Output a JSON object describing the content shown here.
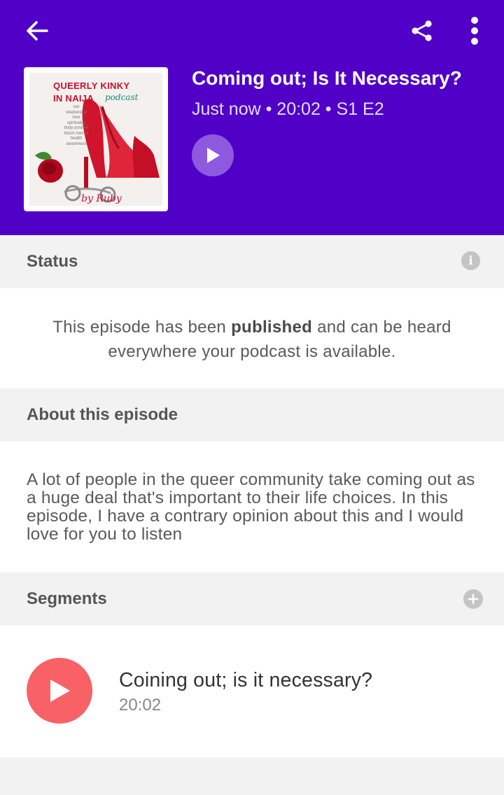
{
  "header": {
    "back_icon": "arrow-left-icon",
    "share_icon": "share-icon",
    "more_icon": "more-vertical-icon",
    "background": "#5000c7"
  },
  "artwork": {
    "line1": "QUEERLY KINKY",
    "line2": "IN NAIJA",
    "podcast": "podcast",
    "tags": [
      "sex",
      "relationship",
      "love",
      "spirituality",
      "body positive",
      "bdsm mental",
      "health",
      "awareness"
    ],
    "byline": "by Ruby"
  },
  "episode": {
    "title": "Coming out; Is It Necessary?",
    "meta": "Just now • 20:02 • S1 E2"
  },
  "status": {
    "heading": "Status",
    "text_before": "This episode has been ",
    "text_bold": "published",
    "text_after": " and can be heard everywhere your podcast is available."
  },
  "about": {
    "heading": "About this episode",
    "text": "A lot of people in the queer community take coming out as a huge deal that's important to their life choices. In this episode, I have a contrary opinion about this and I would love for you to listen"
  },
  "segments": {
    "heading": "Segments",
    "items": [
      {
        "title": "Coining out; is it necessary?",
        "duration": "20:02"
      }
    ]
  },
  "colors": {
    "accent_purple": "#5000c7",
    "play_light": "#8d5adf",
    "segment_play": "#f86266"
  }
}
